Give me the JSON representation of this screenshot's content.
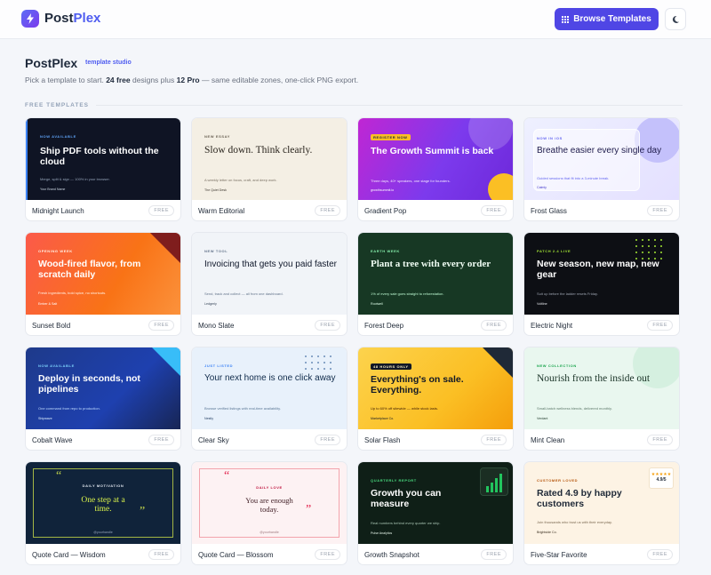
{
  "header": {
    "brand_pre": "Post",
    "brand_accent": "Plex",
    "browse_label": "Browse Templates",
    "icons": {
      "logo": "bolt-icon",
      "browse": "grid-icon",
      "theme": "moon-icon"
    }
  },
  "intro": {
    "title": "PostPlex",
    "badge": "template studio",
    "sub_pre": "Pick a template to start.",
    "sub_free": "24 free",
    "sub_mid": "designs plus",
    "sub_pro": "12 Pro",
    "sub_post": "— same editable zones, one-click PNG export."
  },
  "section": {
    "label": "FREE TEMPLATES"
  },
  "colors": {
    "accent": "#4f46e5",
    "brand": "#4f5df0"
  },
  "templates": [
    {
      "name": "Midnight Launch",
      "tier": "FREE",
      "kicker": "NOW AVAILABLE",
      "headline": "Ship PDF tools without the cloud",
      "body": "Merge, split & sign — 100% in your browser.",
      "footer": "Your Brand Name"
    },
    {
      "name": "Warm Editorial",
      "tier": "FREE",
      "kicker": "NEW ESSAY",
      "headline": "Slow down. Think clearly.",
      "body": "A weekly letter on focus, craft, and deep work.",
      "footer": "The Quiet Desk"
    },
    {
      "name": "Gradient Pop",
      "tier": "FREE",
      "kicker": "REGISTER NOW",
      "headline": "The Growth Summit is back",
      "body": "Three days, 40+ speakers, one stage for founders.",
      "footer": "growthsummit.io"
    },
    {
      "name": "Frost Glass",
      "tier": "FREE",
      "kicker": "NOW IN iOS",
      "headline": "Breathe easier every single day",
      "body": "Guided sessions that fit into a 3-minute break.",
      "footer": "Calmly"
    },
    {
      "name": "Sunset Bold",
      "tier": "FREE",
      "kicker": "OPENING WEEK",
      "headline": "Wood-fired flavor, from scratch daily",
      "body": "Fresh ingredients, bold spice, no shortcuts.",
      "footer": "Ember & Salt"
    },
    {
      "name": "Mono Slate",
      "tier": "FREE",
      "kicker": "NEW TOOL",
      "headline": "Invoicing that gets you paid faster",
      "body": "Send, track and collect — all from one dashboard.",
      "footer": "Ledgerly"
    },
    {
      "name": "Forest Deep",
      "tier": "FREE",
      "kicker": "EARTH WEEK",
      "headline": "Plant a tree with every order",
      "body": "1% of every sale goes straight to reforestation.",
      "footer": "Rootwell"
    },
    {
      "name": "Electric Night",
      "tier": "FREE",
      "kicker": "PATCH 2.4 LIVE",
      "headline": "New season, new map, new gear",
      "body": "Suit up before the ladder resets Friday.",
      "footer": "Voltline"
    },
    {
      "name": "Cobalt Wave",
      "tier": "FREE",
      "kicker": "NOW AVAILABLE",
      "headline": "Deploy in seconds, not pipelines",
      "body": "One command from repo to production.",
      "footer": "Shipwave"
    },
    {
      "name": "Clear Sky",
      "tier": "FREE",
      "kicker": "JUST LISTED",
      "headline": "Your next home is one click away",
      "body": "Browse verified listings with real-time availability.",
      "footer": "Nestly"
    },
    {
      "name": "Solar Flash",
      "tier": "FREE",
      "kicker": "48 HOURS ONLY",
      "headline": "Everything's on sale. Everything.",
      "body": "Up to 60% off sitewide — while stock lasts.",
      "footer": "Marketplace Co."
    },
    {
      "name": "Mint Clean",
      "tier": "FREE",
      "kicker": "NEW COLLECTION",
      "headline": "Nourish from the inside out",
      "body": "Small-batch wellness blends, delivered monthly.",
      "footer": "Verdant"
    },
    {
      "name": "Quote Card — Wisdom",
      "tier": "FREE",
      "kicker": "DAILY MOTIVATION",
      "headline": "One step at a time.",
      "footer": "@yourhandle"
    },
    {
      "name": "Quote Card — Blossom",
      "tier": "FREE",
      "kicker": "DAILY LOVE",
      "headline": "You are enough today.",
      "footer": "@yourhandle"
    },
    {
      "name": "Growth Snapshot",
      "tier": "FREE",
      "kicker": "QUARTERLY REPORT",
      "headline": "Growth you can measure",
      "body": "Real numbers behind every quarter we ship.",
      "footer": "Pulse Analytics"
    },
    {
      "name": "Five-Star Favorite",
      "tier": "FREE",
      "kicker": "CUSTOMER LOVED",
      "headline": "Rated 4.9 by happy customers",
      "body": "Join thousands who trust us with their everyday.",
      "footer": "Brightside Co.",
      "rating": "4.9/5"
    }
  ]
}
